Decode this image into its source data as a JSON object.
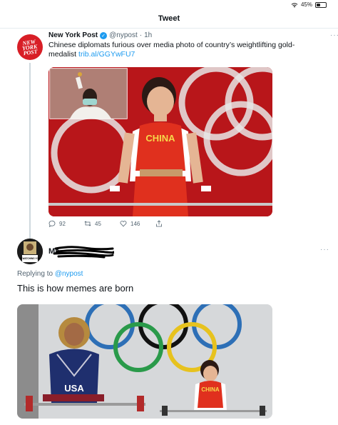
{
  "status_bar": {
    "battery_text": "45%",
    "battery_level": 0.45
  },
  "header": {
    "title": "Tweet"
  },
  "tweet": {
    "avatar_text": [
      "NEW",
      "YORK",
      "POST"
    ],
    "author_name": "New York Post",
    "handle": "@nypost",
    "dot": "·",
    "time": "1h",
    "more": "···",
    "text": "Chinese diplomats furious over media photo of country’s weightlifting gold-medalist",
    "link": "trib.al/GGYwFU7",
    "media_jersey_text": "CHINA",
    "actions": {
      "replies": "92",
      "retweets": "45",
      "likes": "146"
    }
  },
  "reply": {
    "avatar_caption": "IS WATCHING YOU",
    "name_visible": "Ma",
    "more": "···",
    "replying_prefix": "Replying to",
    "replying_handle": "@nypost",
    "text": "This is how memes are born",
    "media_left_text": "USA",
    "media_right_text": "CHINA"
  },
  "colors": {
    "link": "#1d9bf0",
    "nyp_red": "#d81e26",
    "muted": "#536471"
  }
}
